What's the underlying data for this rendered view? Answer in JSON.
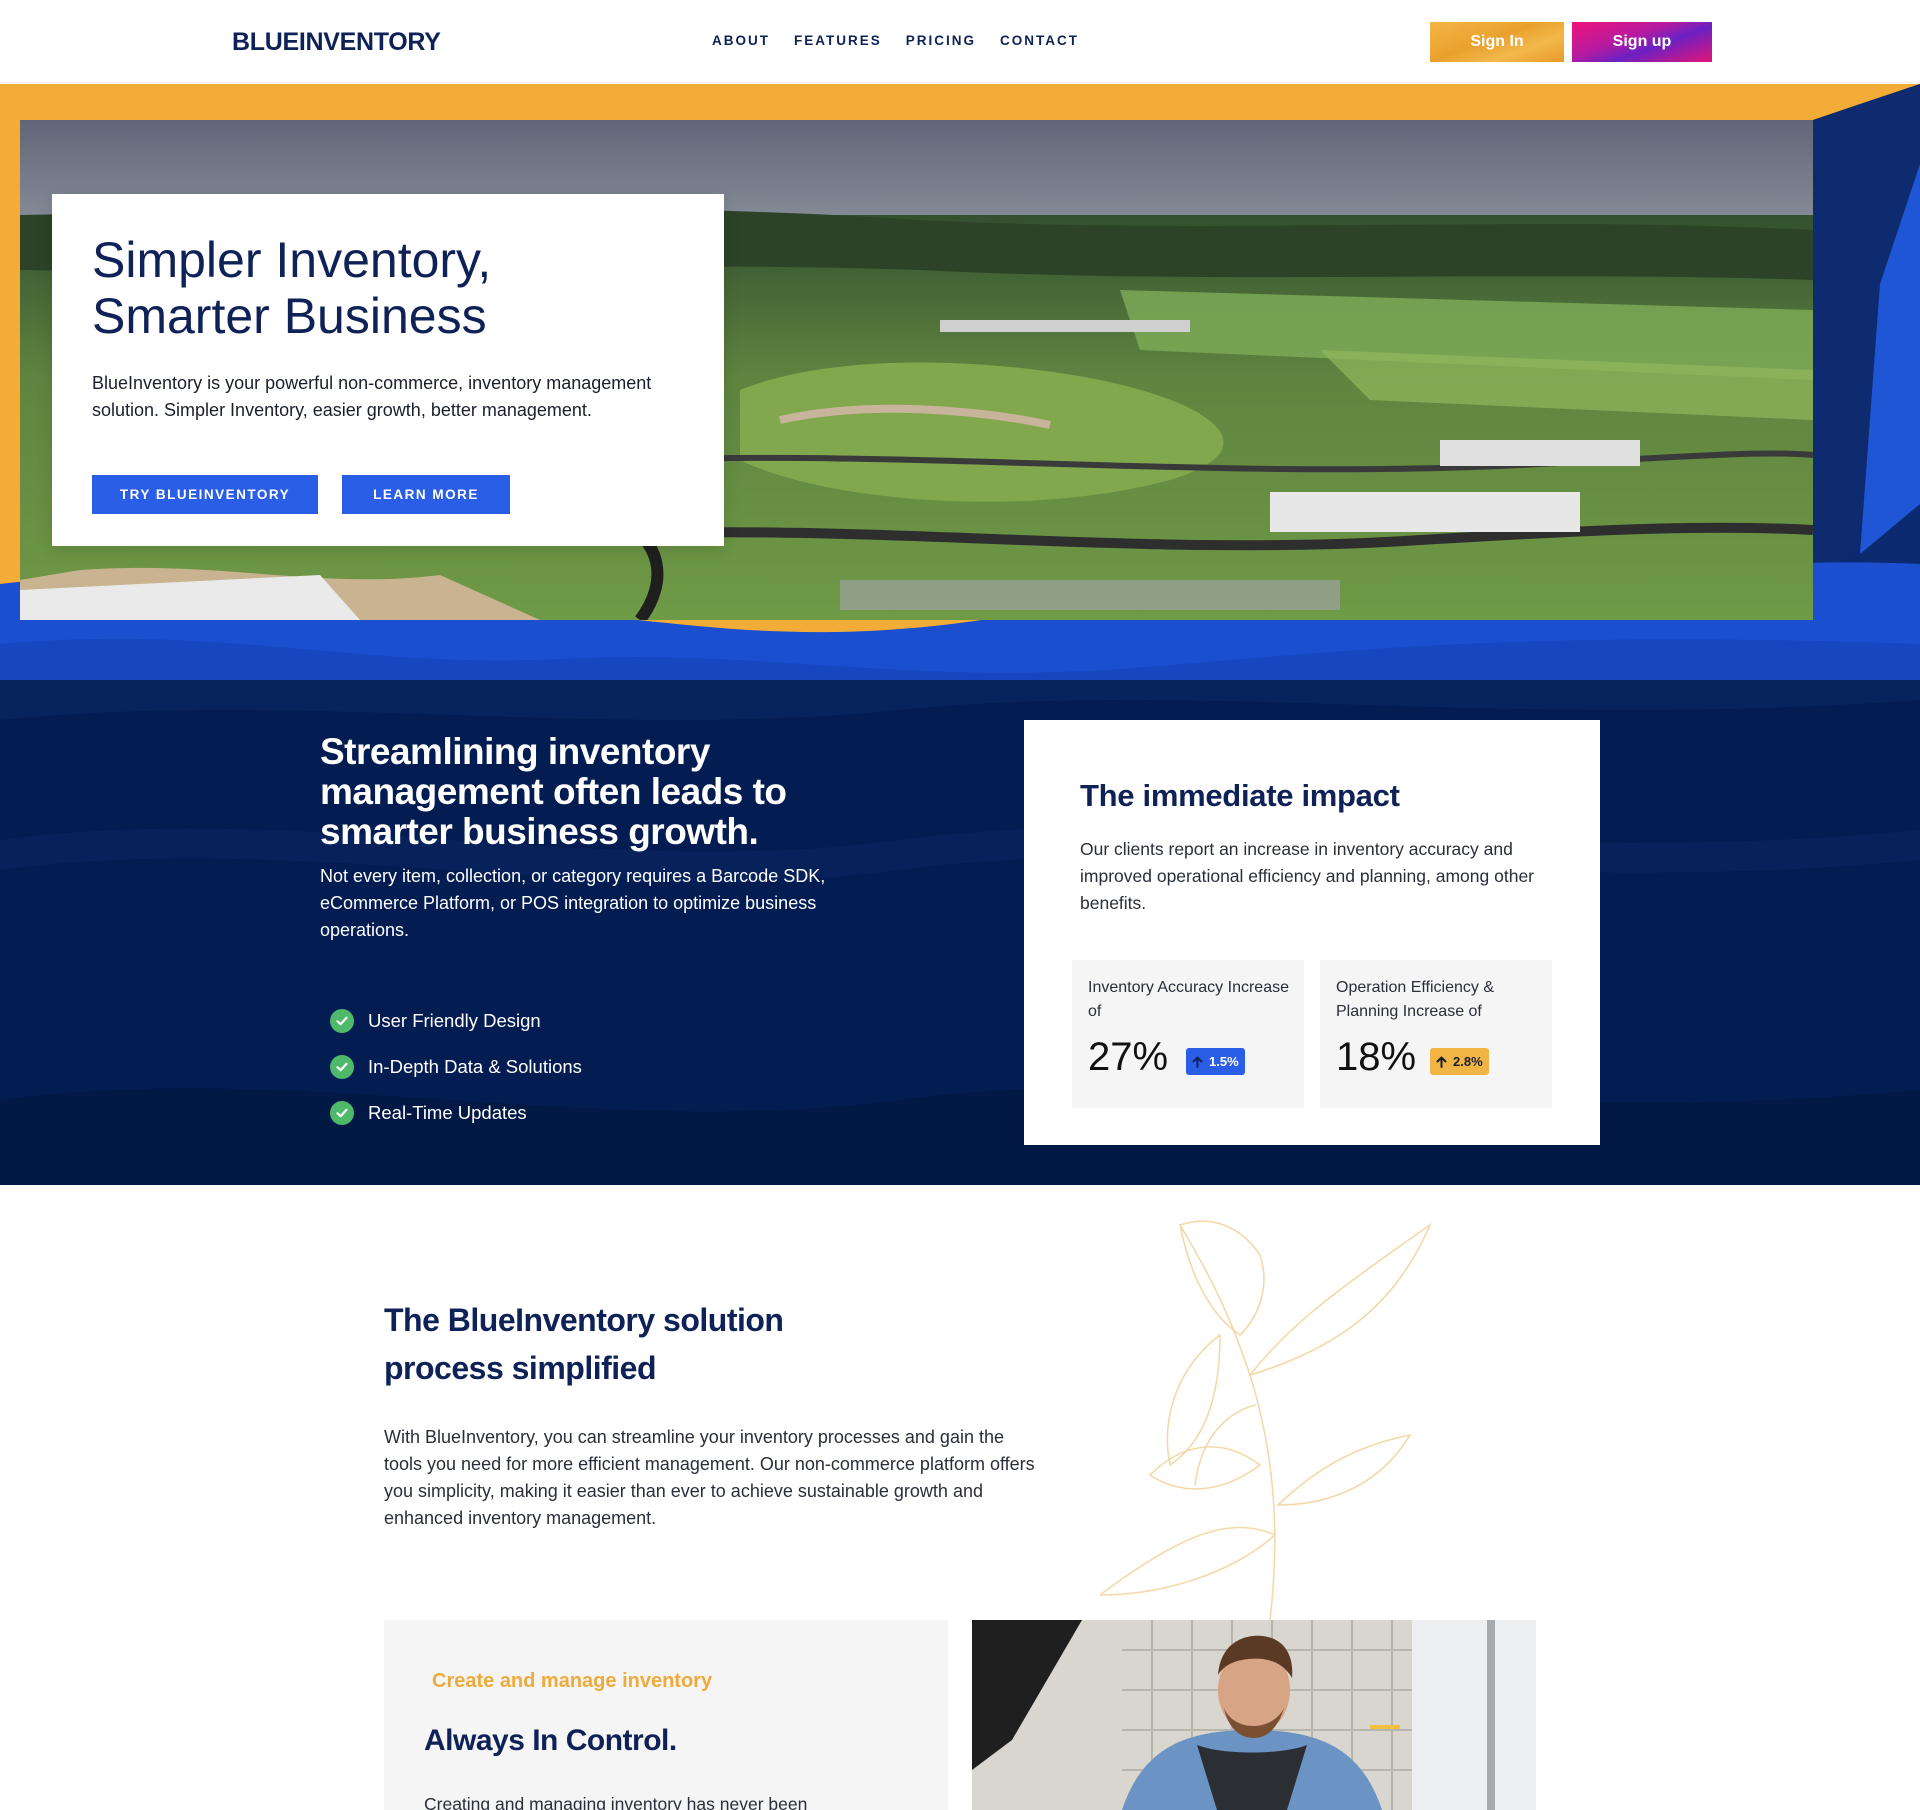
{
  "header": {
    "logo": "BLUEINVENTORY",
    "nav": [
      "ABOUT",
      "FEATURES",
      "PRICING",
      "CONTACT"
    ],
    "signin_label": "Sign In",
    "signup_label": "Sign up"
  },
  "hero": {
    "title_line1": "Simpler Inventory,",
    "title_line2": "Smarter Business",
    "description": "BlueInventory is your powerful non-commerce, inventory management solution. Simpler Inventory, easier growth, better management.",
    "try_label": "TRY BLUEINVENTORY",
    "learn_label": "LEARN MORE"
  },
  "growth": {
    "headline": "Streamlining inventory management often leads to smarter business growth.",
    "description": "Not every item, collection, or category requires a Barcode SDK, eCommerce Platform, or POS integration to optimize business operations.",
    "features": [
      "User Friendly Design",
      "In-Depth Data & Solutions",
      "Real-Time Updates"
    ]
  },
  "impact": {
    "title": "The immediate impact",
    "description": "Our clients report an increase in inventory accuracy and improved operational efficiency and planning, among other benefits.",
    "stats": [
      {
        "label": "Inventory Accuracy Increase of",
        "value": "27%",
        "change": "1.5%",
        "color": "#2b5ee6"
      },
      {
        "label": "Operation Efficiency & Planning Increase of",
        "value": "18%",
        "change": "2.8%",
        "color": "#f0b545"
      }
    ]
  },
  "solution": {
    "title_line1": "The BlueInventory solution",
    "title_line2": "process simplified",
    "description": "With BlueInventory, you can streamline your inventory processes and gain the tools you need for more efficient management. Our non-commerce platform offers you simplicity, making it easier than ever to achieve sustainable growth and enhanced inventory management."
  },
  "feature_card": {
    "kicker": "Create and manage inventory",
    "title": "Always In Control.",
    "text": "Creating and managing inventory has never been"
  },
  "icons": [
    "check-icon",
    "arrow-up-icon",
    "leaf-decoration-icon"
  ],
  "colors": {
    "brand_navy": "#0f2257",
    "accent_blue": "#2b5ee6",
    "accent_orange": "#f4ac38",
    "dark_bg": "#031c51",
    "check_green": "#4fb96a"
  }
}
